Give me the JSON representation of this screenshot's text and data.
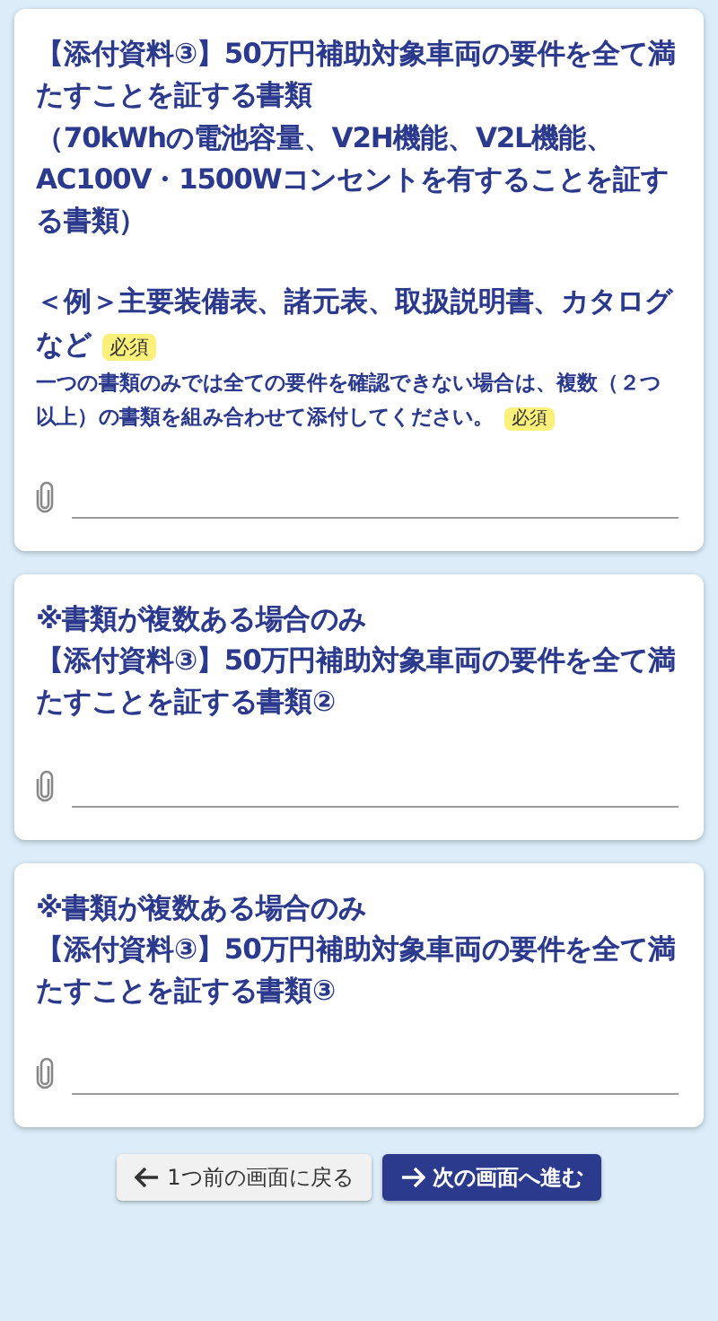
{
  "cards": [
    {
      "title": "【添付資料③】50万円補助対象車両の要件を全て満たすことを証する書類",
      "detail": "（70kWhの電池容量、V2H機能、V2L機能、AC100V・1500Wコンセントを有することを証する書類）",
      "example": "＜例＞主要装備表、諸元表、取扱説明書、カタログなど",
      "example_required": "必須",
      "note": "一つの書類のみでは全ての要件を確認できない場合は、複数（２つ以上）の書類を組み合わせて添付してください。",
      "note_required": "必須"
    },
    {
      "notice": "※書類が複数ある場合のみ",
      "title": "【添付資料③】50万円補助対象車両の要件を全て満たすことを証する書類②"
    },
    {
      "notice": "※書類が複数ある場合のみ",
      "title": "【添付資料③】50万円補助対象車両の要件を全て満たすことを証する書類③"
    }
  ],
  "buttons": [
    {
      "label": "1つ前の画面に戻る",
      "kind": "back"
    },
    {
      "label": "次の画面へ進む",
      "kind": "next"
    }
  ]
}
